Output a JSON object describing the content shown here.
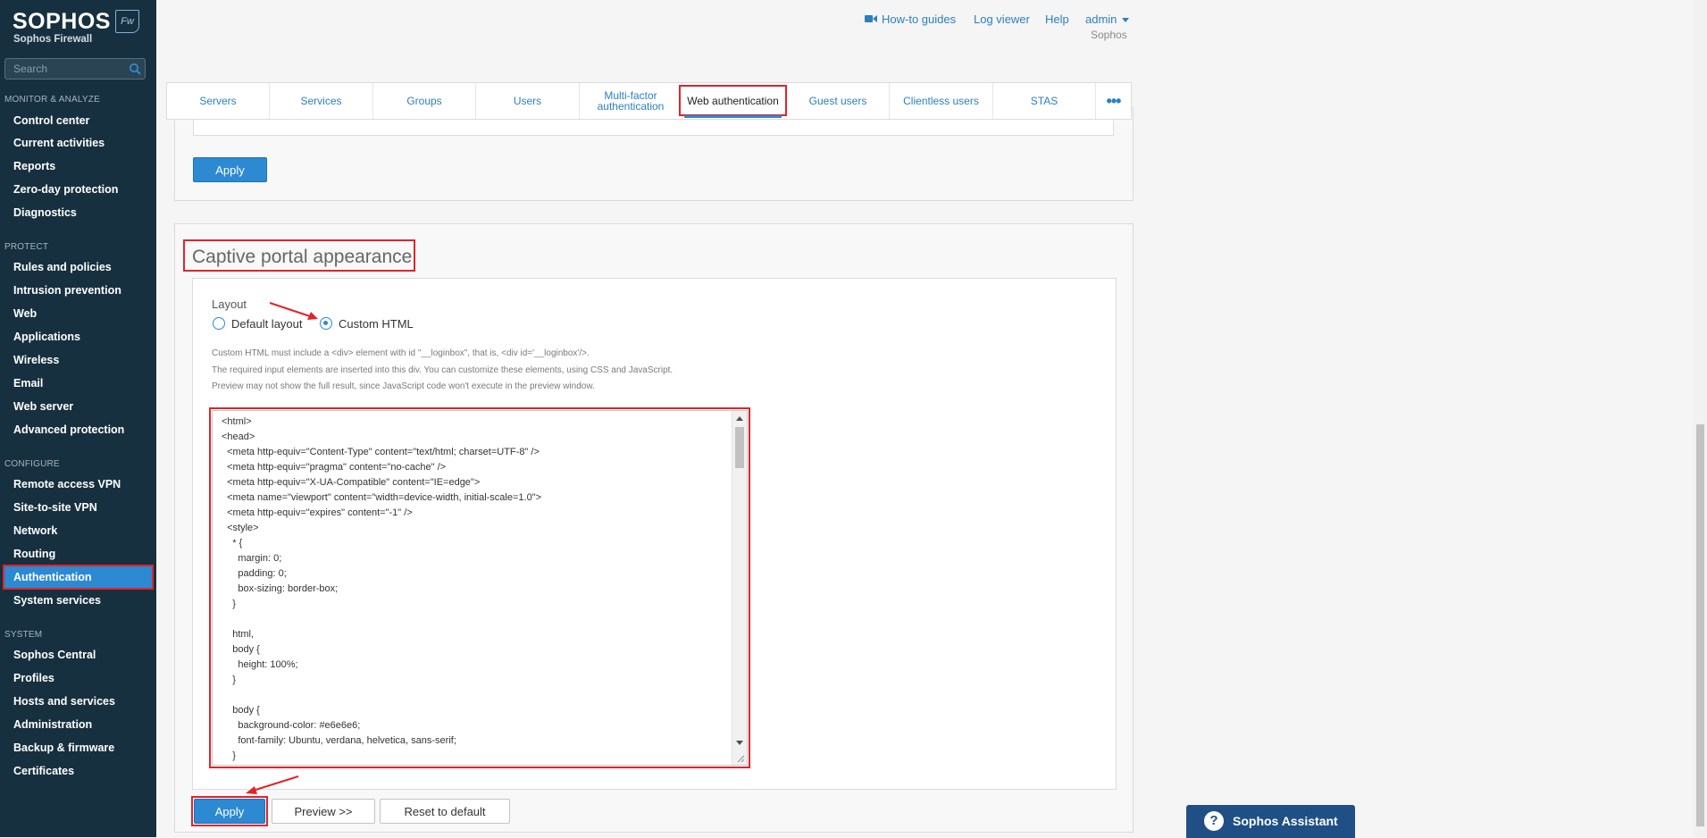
{
  "brand": {
    "wordmark": "SOPHOS",
    "badge": "Fw",
    "subtitle": "Sophos Firewall"
  },
  "search": {
    "placeholder": "Search"
  },
  "sidebar": {
    "sections": [
      {
        "title": "MONITOR & ANALYZE",
        "items": [
          "Control center",
          "Current activities",
          "Reports",
          "Zero-day protection",
          "Diagnostics"
        ]
      },
      {
        "title": "PROTECT",
        "items": [
          "Rules and policies",
          "Intrusion prevention",
          "Web",
          "Applications",
          "Wireless",
          "Email",
          "Web server",
          "Advanced protection"
        ]
      },
      {
        "title": "CONFIGURE",
        "items": [
          "Remote access VPN",
          "Site-to-site VPN",
          "Network",
          "Routing",
          "Authentication",
          "System services"
        ]
      },
      {
        "title": "SYSTEM",
        "items": [
          "Sophos Central",
          "Profiles",
          "Hosts and services",
          "Administration",
          "Backup & firmware",
          "Certificates"
        ]
      }
    ],
    "active_item": "Authentication"
  },
  "topbar": {
    "howto": "How-to guides",
    "log_viewer": "Log viewer",
    "help": "Help",
    "user": "admin",
    "org": "Sophos"
  },
  "tabs": [
    "Servers",
    "Services",
    "Groups",
    "Users",
    "Multi-factor authentication",
    "Web authentication",
    "Guest users",
    "Clientless users",
    "STAS",
    "•••"
  ],
  "active_tab": "Web authentication",
  "upper_panel": {
    "apply_label": "Apply"
  },
  "captive_portal": {
    "title": "Captive portal appearance",
    "layout_label": "Layout",
    "options": [
      "Default layout",
      "Custom HTML"
    ],
    "selected": "Custom HTML",
    "help": [
      "Custom HTML must include a <div> element with id \"__loginbox\", that is, <div id='__loginbox'/>.",
      "The required input elements are inserted into this div. You can customize these elements, using CSS and JavaScript.",
      "Preview may not show the full result, since JavaScript code won't execute in the preview window."
    ],
    "code": "<html>\n<head>\n  <meta http-equiv=\"Content-Type\" content=\"text/html; charset=UTF-8\" />\n  <meta http-equiv=\"pragma\" content=\"no-cache\" />\n  <meta http-equiv=\"X-UA-Compatible\" content=\"IE=edge\">\n  <meta name=\"viewport\" content=\"width=device-width, initial-scale=1.0\">\n  <meta http-equiv=\"expires\" content=\"-1\" />\n  <style>\n    * {\n      margin: 0;\n      padding: 0;\n      box-sizing: border-box;\n    }\n\n    html,\n    body {\n      height: 100%;\n    }\n\n    body {\n      background-color: #e6e6e6;\n      font-family: Ubuntu, verdana, helvetica, sans-serif;\n    }",
    "buttons": {
      "apply": "Apply",
      "preview": "Preview >>",
      "reset": "Reset to default"
    }
  },
  "assistant": {
    "label": "Sophos Assistant"
  },
  "colors": {
    "sidebar_bg": "#17303f",
    "accent": "#2c89d2",
    "highlight": "#e0242b",
    "link": "#2c7fbf"
  }
}
